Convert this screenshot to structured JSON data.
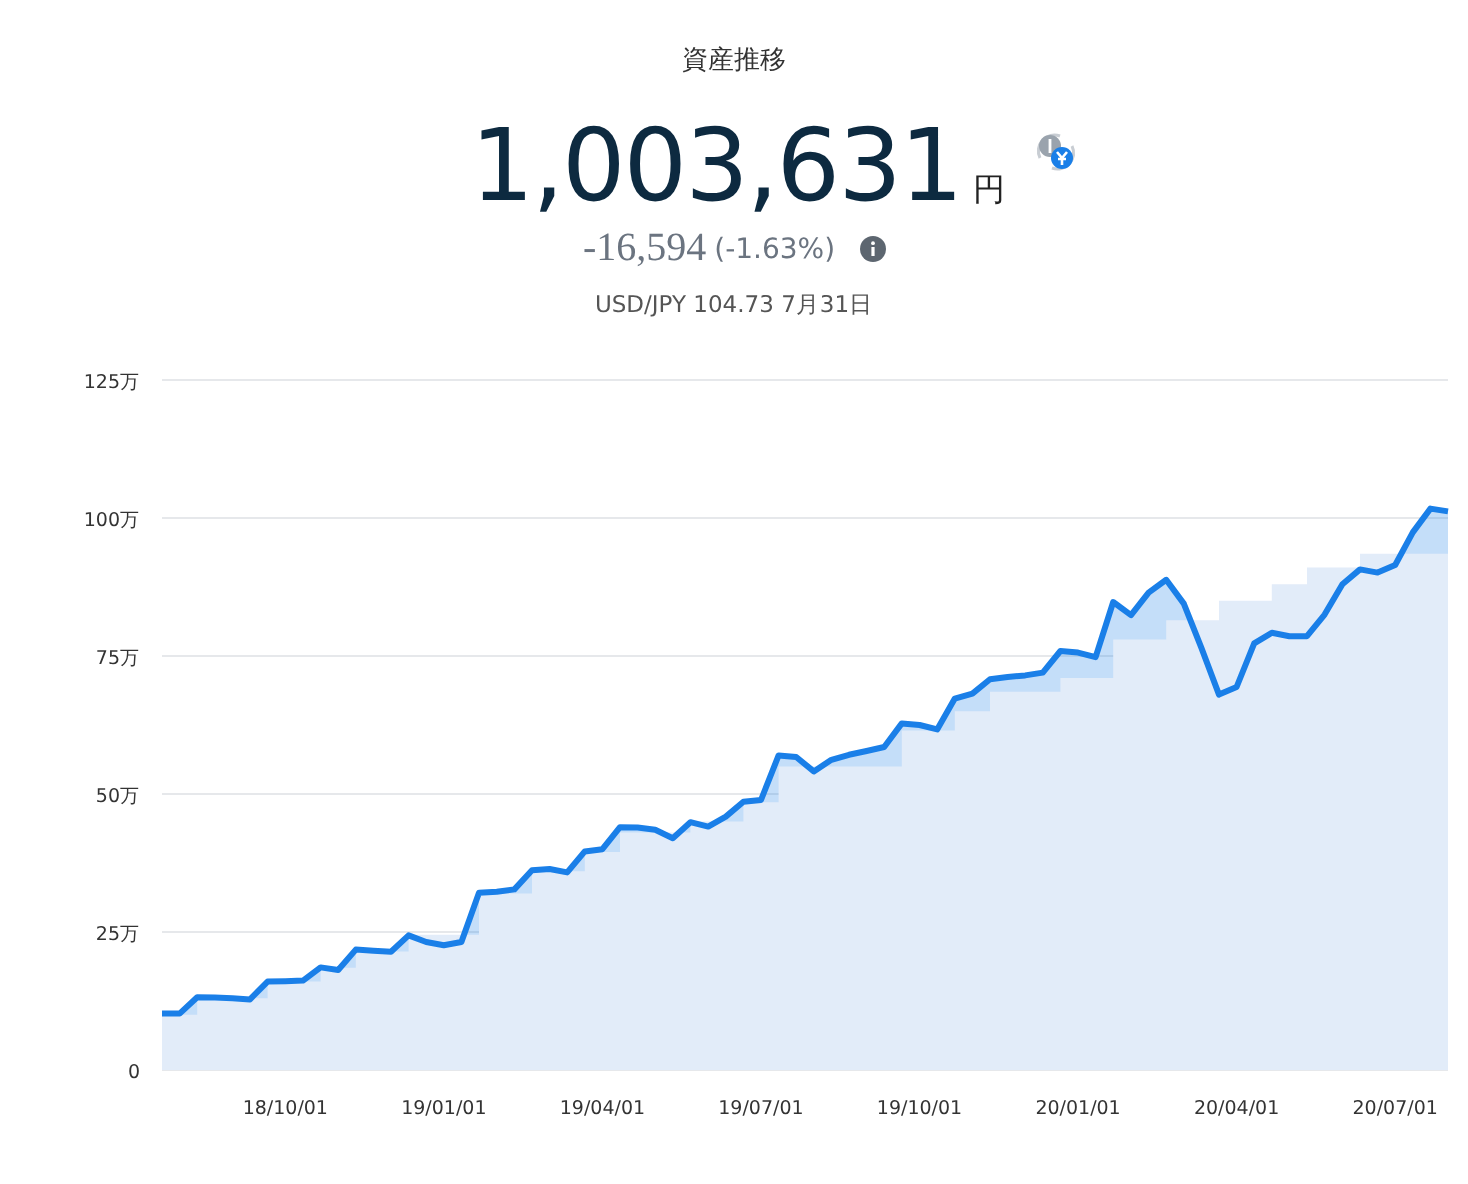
{
  "header": {
    "title": "資産推移",
    "total": "1,003,631",
    "unit": "円",
    "change": "-16,594",
    "change_percent": "(-1.63%)",
    "rate": "USD/JPY 104.73 7月31日"
  },
  "chart": {
    "chart_data": {
      "type": "area",
      "grid": true,
      "ylim": [
        0,
        125
      ],
      "categories": [
        null,
        null,
        null,
        null,
        null,
        null,
        null,
        "18/10/01",
        null,
        null,
        null,
        null,
        null,
        null,
        null,
        null,
        "19/01/01",
        null,
        null,
        null,
        null,
        null,
        null,
        null,
        null,
        "19/04/01",
        null,
        null,
        null,
        null,
        null,
        null,
        null,
        null,
        "19/07/01",
        null,
        null,
        null,
        null,
        null,
        null,
        null,
        null,
        "19/10/01",
        null,
        null,
        null,
        null,
        null,
        null,
        null,
        null,
        "20/01/01",
        null,
        null,
        null,
        null,
        null,
        null,
        null,
        null,
        "20/04/01",
        null,
        null,
        null,
        null,
        null,
        null,
        null,
        null,
        "20/07/01",
        null,
        null,
        null
      ],
      "yticks": [
        {
          "value": 0,
          "label": "0"
        },
        {
          "value": 25,
          "label": "25万"
        },
        {
          "value": 50,
          "label": "50万"
        },
        {
          "value": 75,
          "label": "75万"
        },
        {
          "value": 100,
          "label": "100万"
        },
        {
          "value": 125,
          "label": "125万"
        }
      ],
      "series": [
        {
          "color": "#1a7fe8",
          "values": [
            10.2,
            10.2,
            13.2,
            13.1,
            13,
            12.8,
            16,
            16.1,
            16.2,
            18.6,
            18.1,
            21.8,
            21.6,
            21.4,
            24.4,
            23.2,
            22.6,
            23.2,
            32.1,
            32.3,
            32.7,
            36.2,
            36.4,
            35.8,
            39.6,
            40,
            44,
            43.9,
            43.5,
            42,
            44.9,
            44.1,
            45.9,
            48.6,
            48.9,
            57,
            56.7,
            54.1,
            56.2,
            57.1,
            57.8,
            58.5,
            62.8,
            62.5,
            61.7,
            67.3,
            68.2,
            70.8,
            71.2,
            71.5,
            72,
            75.9,
            75.6,
            74.8,
            84.8,
            82.4,
            86.5,
            88.8,
            84.5,
            76.5,
            68,
            69.4,
            77.3,
            79.2,
            78.6,
            78.6,
            82.5,
            88,
            90.7,
            90.1,
            91.5,
            97.4,
            101.7,
            101.2
          ]
        },
        {
          "color": "#e2ecf9",
          "values": [
            10,
            10,
            13,
            13,
            13,
            13,
            16,
            16,
            16,
            18.5,
            18.5,
            21.5,
            21.5,
            21.5,
            24.5,
            24.5,
            24.5,
            24.5,
            32,
            32,
            32,
            36,
            36,
            36,
            39.5,
            39.5,
            43,
            43,
            43,
            43,
            45,
            45,
            45,
            48.5,
            48.5,
            55,
            55,
            55,
            55,
            55,
            55,
            55,
            61.5,
            61.5,
            61.5,
            65,
            65,
            68.5,
            68.5,
            68.5,
            68.5,
            71,
            71,
            71,
            78,
            78,
            78,
            81.5,
            81.5,
            81.5,
            85,
            85,
            85,
            88,
            88,
            91,
            91,
            91,
            93.5,
            93.5,
            93.5,
            93.5,
            93.5,
            93.5
          ]
        }
      ]
    }
  }
}
